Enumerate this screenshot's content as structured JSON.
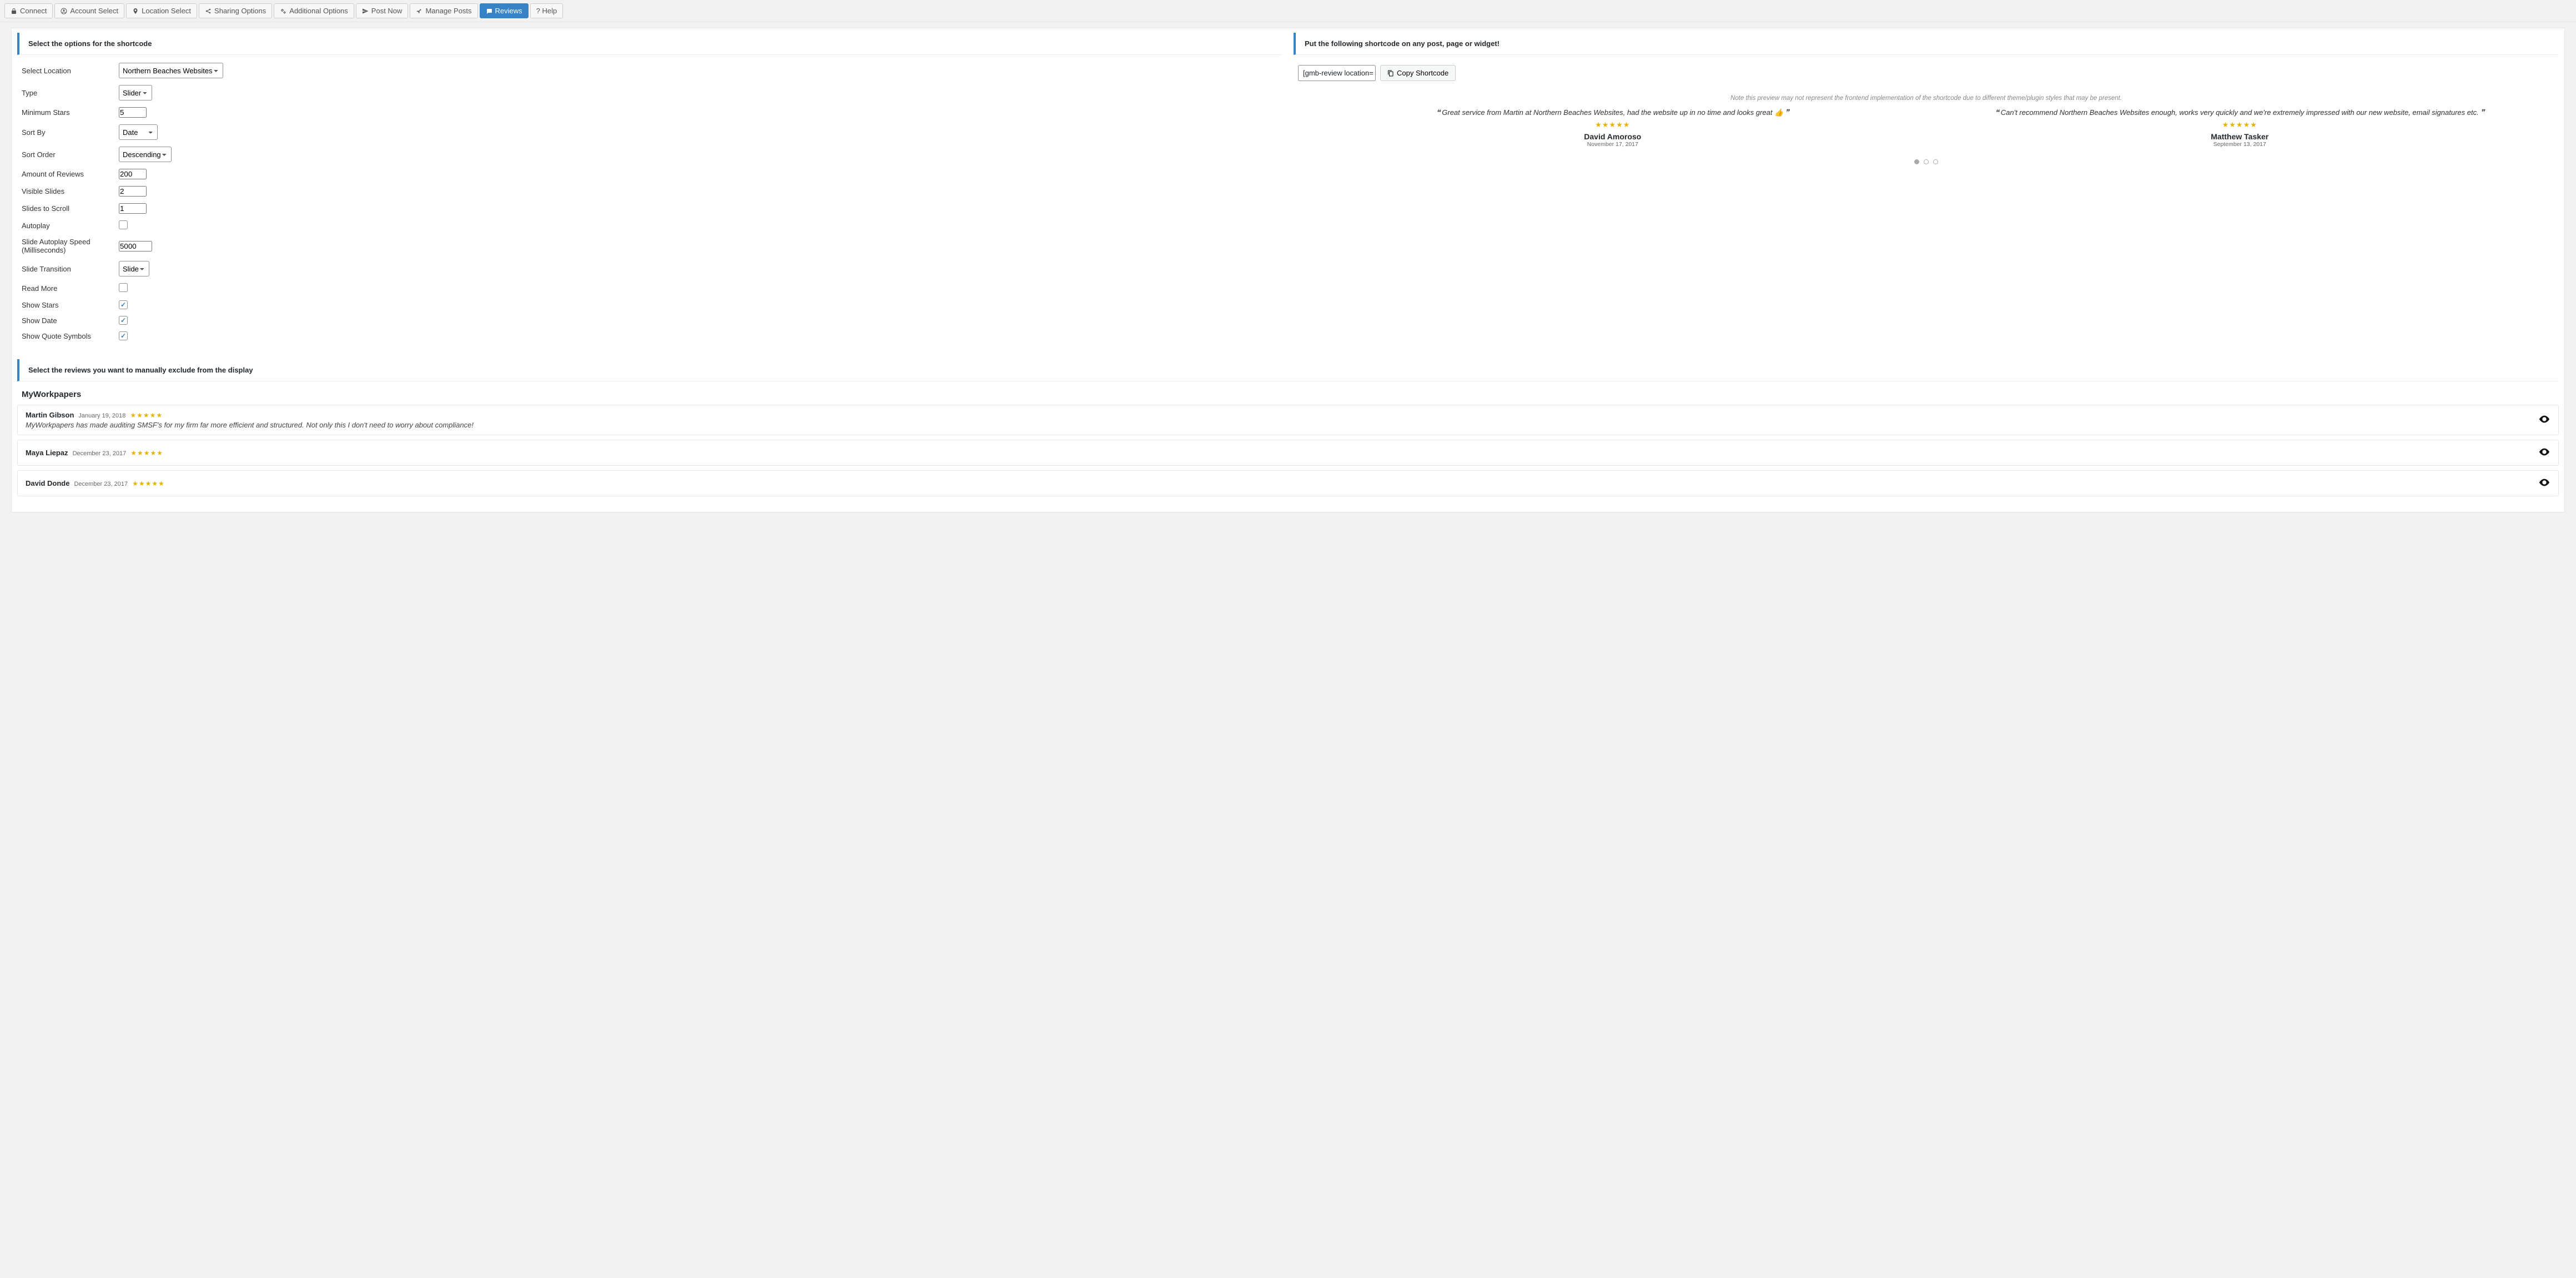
{
  "toolbar": {
    "connect": "Connect",
    "account_select": "Account Select",
    "location_select": "Location Select",
    "sharing_options": "Sharing Options",
    "additional_options": "Additional Options",
    "post_now": "Post Now",
    "manage_posts": "Manage Posts",
    "reviews": "Reviews",
    "help": "? Help"
  },
  "left": {
    "title": "Select the options for the shortcode",
    "rows": {
      "select_location_label": "Select Location",
      "select_location_value": "Northern Beaches Websites",
      "type_label": "Type",
      "type_value": "Slider",
      "min_stars_label": "Minimum Stars",
      "min_stars_value": "5",
      "sort_by_label": "Sort By",
      "sort_by_value": "Date",
      "sort_order_label": "Sort Order",
      "sort_order_value": "Descending",
      "amount_label": "Amount of Reviews",
      "amount_value": "200",
      "visible_label": "Visible Slides",
      "visible_value": "2",
      "scroll_label": "Slides to Scroll",
      "scroll_value": "1",
      "autoplay_label": "Autoplay",
      "speed_label": "Slide Autoplay Speed (Milliseconds)",
      "speed_value": "5000",
      "transition_label": "Slide Transition",
      "transition_value": "Slide",
      "readmore_label": "Read More",
      "stars_label": "Show Stars",
      "date_label": "Show Date",
      "quote_label": "Show Quote Symbols"
    }
  },
  "right": {
    "title": "Put the following shortcode on any post, page or widget!",
    "shortcode_value": "[gmb-review location=",
    "copy": "Copy Shortcode",
    "note": "Note this preview may not represent the frontend implementation of the shortcode due to different theme/plugin styles that may be present.",
    "slides": [
      {
        "text": "Great service from Martin at Northern Beaches Websites, had the website up in no time and looks great 👍",
        "name": "David Amoroso",
        "date": "November 17, 2017"
      },
      {
        "text": "Can't recommend Northern Beaches Websites enough, works very quickly and we're extremely impressed with our new website, email signatures etc.",
        "name": "Matthew Tasker",
        "date": "September 13, 2017"
      }
    ]
  },
  "exclude": {
    "title": "Select the reviews you want to manually exclude from the display",
    "location_name": "MyWorkpapers",
    "items": [
      {
        "name": "Martin Gibson",
        "date": "January 19, 2018",
        "body": "MyWorkpapers has made auditing SMSF's for my firm far more efficient and structured. Not only this I don't need to worry about compliance!"
      },
      {
        "name": "Maya Liepaz",
        "date": "December 23, 2017",
        "body": ""
      },
      {
        "name": "David Donde",
        "date": "December 23, 2017",
        "body": ""
      }
    ]
  }
}
